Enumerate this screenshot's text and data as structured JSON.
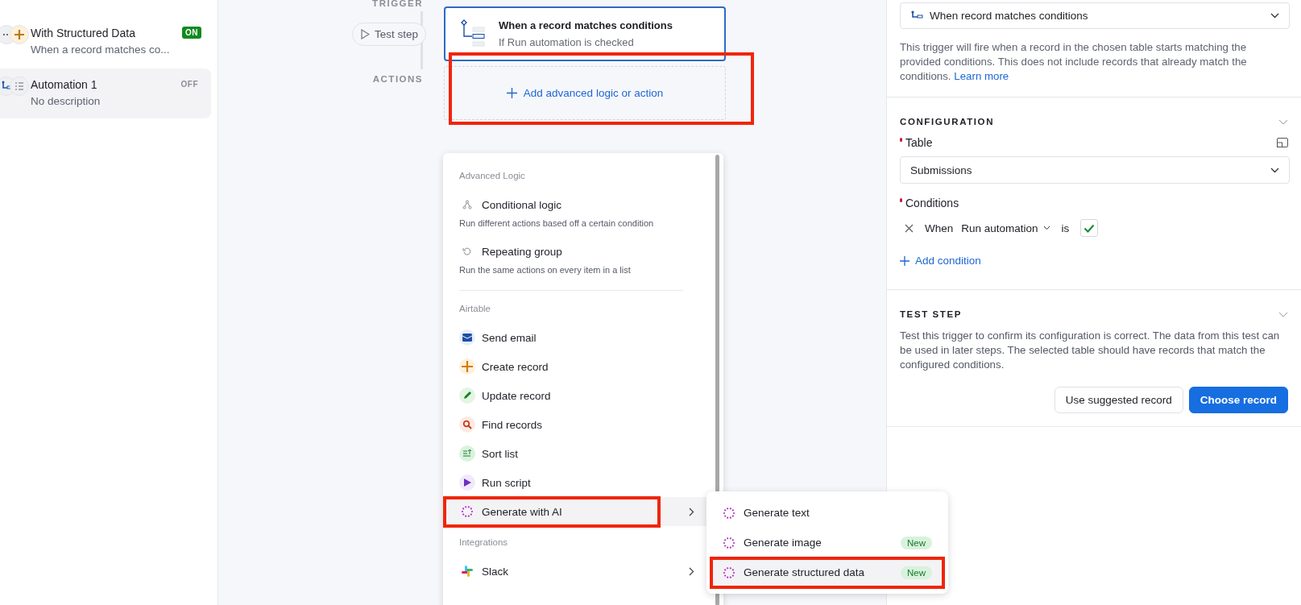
{
  "sidebar": {
    "items": [
      {
        "title": "With Structured Data",
        "subtitle": "When a record matches co...",
        "status": "ON",
        "on": true,
        "selected": false,
        "kind": "create"
      },
      {
        "title": "Automation 1",
        "subtitle": "No description",
        "status": "OFF",
        "on": false,
        "selected": true,
        "kind": "trigger"
      }
    ]
  },
  "canvas": {
    "trigger_label": "TRIGGER",
    "test_step": "Test step",
    "trigger_card": {
      "title": "When a record matches conditions",
      "subtitle": "If Run automation is checked",
      "selected": true
    },
    "actions_label": "ACTIONS",
    "add_action": {
      "label": "Add advanced logic or action",
      "highlighted": true
    }
  },
  "menu": {
    "sections": [
      {
        "heading": "Advanced Logic",
        "items": [
          {
            "kind": "conditional",
            "label": "Conditional logic",
            "description": "Run different actions based off a certain condition",
            "submenu": false,
            "hovered": false,
            "highlighted": false
          },
          {
            "kind": "repeat",
            "label": "Repeating group",
            "description": "Run the same actions on every item in a list",
            "submenu": false,
            "hovered": false,
            "highlighted": false
          }
        ]
      },
      {
        "heading": "Airtable",
        "items": [
          {
            "kind": "email",
            "label": "Send email",
            "submenu": false,
            "hovered": false,
            "highlighted": false
          },
          {
            "kind": "create",
            "label": "Create record",
            "submenu": false,
            "hovered": false,
            "highlighted": false
          },
          {
            "kind": "update",
            "label": "Update record",
            "submenu": false,
            "hovered": false,
            "highlighted": false
          },
          {
            "kind": "find",
            "label": "Find records",
            "submenu": false,
            "hovered": false,
            "highlighted": false
          },
          {
            "kind": "sort",
            "label": "Sort list",
            "submenu": false,
            "hovered": false,
            "highlighted": false
          },
          {
            "kind": "script",
            "label": "Run script",
            "submenu": false,
            "hovered": false,
            "highlighted": false
          },
          {
            "kind": "ai",
            "label": "Generate with AI",
            "submenu": true,
            "hovered": true,
            "highlighted": true
          }
        ]
      },
      {
        "heading": "Integrations",
        "items": [
          {
            "kind": "slack",
            "label": "Slack",
            "submenu": true,
            "hovered": false,
            "highlighted": false
          }
        ]
      }
    ]
  },
  "submenu": {
    "items": [
      {
        "kind": "ai",
        "label": "Generate text",
        "hovered": false,
        "highlighted": false
      },
      {
        "kind": "ai",
        "label": "Generate image",
        "badge": "New",
        "hovered": false,
        "highlighted": false
      },
      {
        "kind": "ai",
        "label": "Generate structured data",
        "badge": "New",
        "hovered": true,
        "highlighted": true
      }
    ]
  },
  "panel": {
    "trigger_select": "When record matches conditions",
    "description": "This trigger will fire when a record in the chosen table starts matching the provided conditions. This does not include records that already match the conditions.",
    "learn_more": "Learn more",
    "configuration": {
      "heading": "CONFIGURATION",
      "expanded": true,
      "table_label": "Table",
      "table_required": true,
      "table_value": "Submissions",
      "conditions_label": "Conditions",
      "conditions_required": true,
      "condition": {
        "prefix": "When",
        "field": "Run automation",
        "operator": "is",
        "checked": true
      },
      "add_condition": "Add condition"
    },
    "test_step": {
      "heading": "TEST STEP",
      "expanded": true,
      "description": "Test this trigger to confirm its configuration is correct. The data from this test can be used in later steps. The selected table should have records that match the configured conditions.",
      "buttons": [
        {
          "label": "Use suggested record",
          "primary": false
        },
        {
          "label": "Choose record",
          "primary": true
        }
      ]
    }
  }
}
